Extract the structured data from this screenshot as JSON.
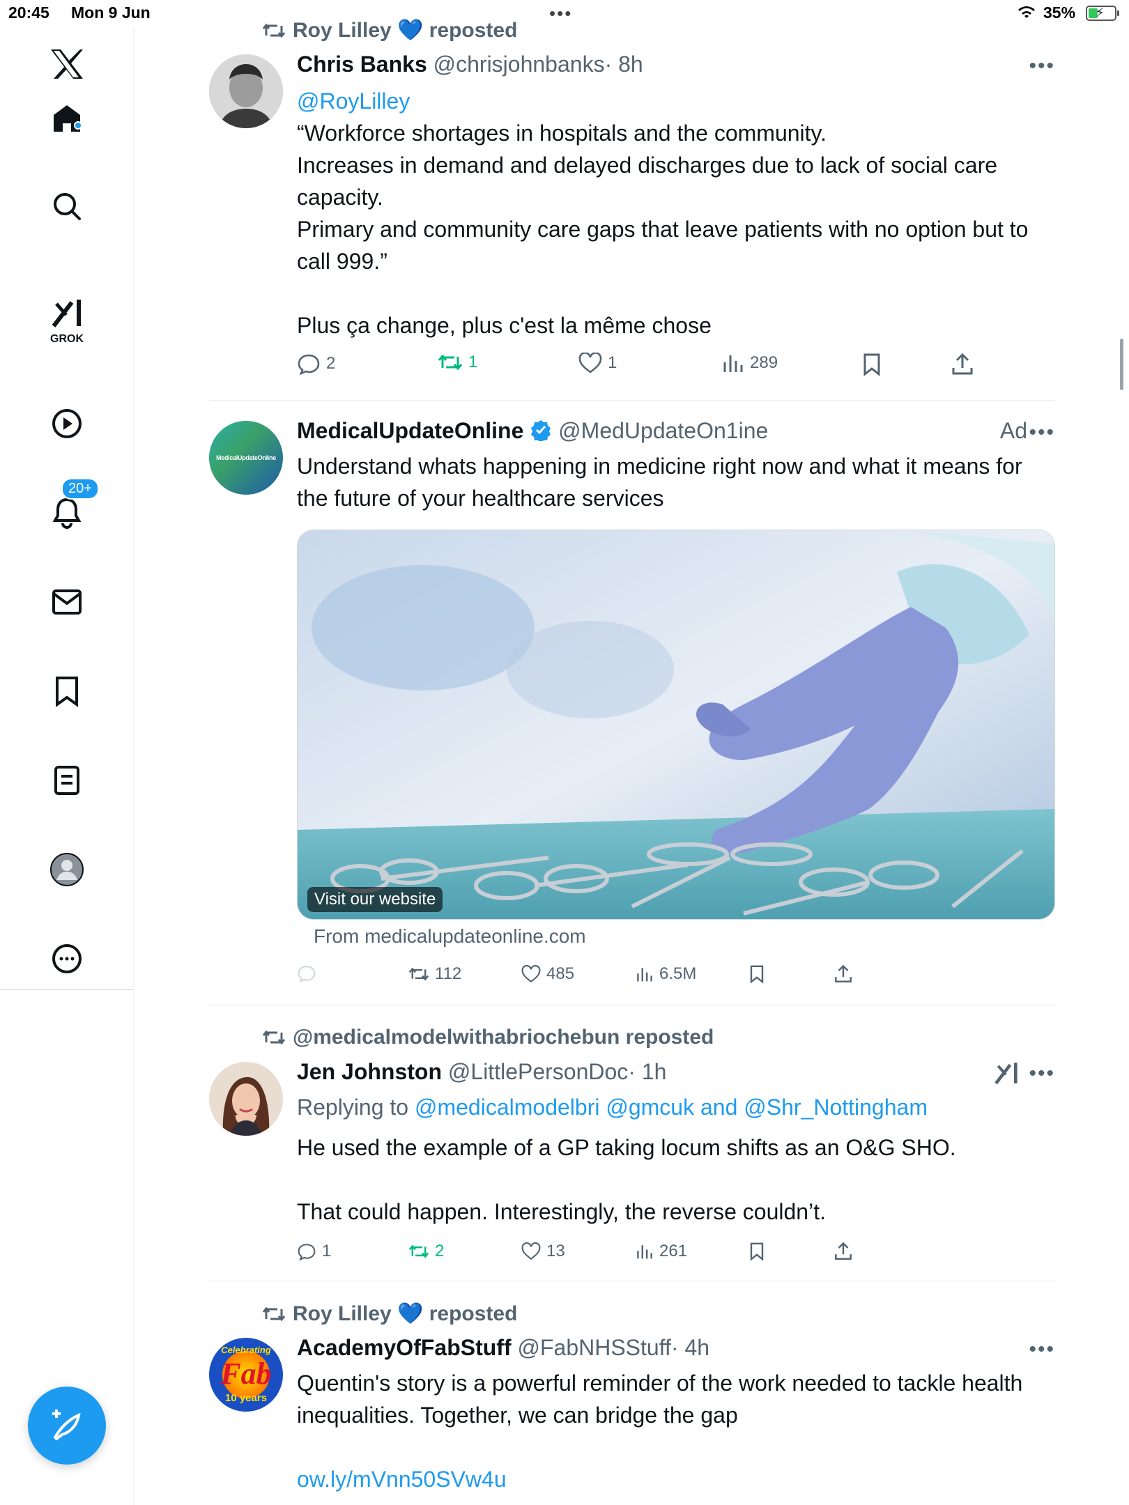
{
  "status_bar": {
    "time": "20:45",
    "date": "Mon 9 Jun",
    "battery": "35%",
    "battery_level_fraction": 0.35
  },
  "sidebar": {
    "grok_label": "GROK",
    "notifications_badge": "20+",
    "items": [
      "x-logo",
      "home",
      "search",
      "grok",
      "video",
      "notifications",
      "messages",
      "bookmarks",
      "lists",
      "profile",
      "more"
    ]
  },
  "posts": [
    {
      "repost_by": "Roy Lilley 💙 reposted",
      "name": "Chris Banks",
      "handle": "@chrisjohnbanks",
      "time": "· 8h",
      "body": [
        "@RoyLilley",
        "“Workforce shortages in hospitals and the community.",
        "Increases in demand and delayed discharges due to lack of social care capacity.",
        "Primary and community care gaps that leave patients with no option but to call 999.”",
        "",
        "Plus ça change, plus c'est la même chose"
      ],
      "replies": "2",
      "reposts": "1",
      "likes": "1",
      "views": "289"
    },
    {
      "name": "MedicalUpdateOnline",
      "handle": "@MedUpdateOn1ine",
      "ad_label": "Ad",
      "avatar_text": "MedicalUpdateOnline",
      "body": "Understand whats happening in medicine right now and what it means for the future of your healthcare services",
      "media_label": "Visit our website",
      "from": "From medicalupdateonline.com",
      "replies": "",
      "reposts": "112",
      "likes": "485",
      "views": "6.5M"
    },
    {
      "repost_by": "@medicalmodelwithabriochebun reposted",
      "name": "Jen Johnston",
      "handle": "@LittlePersonDoc",
      "time": "· 1h",
      "replying_prefix": "Replying to",
      "replying_to": "@medicalmodelbri @gmcuk and @Shr_Nottingham",
      "body": [
        "He used the example of a GP taking locum shifts as an O&G SHO.",
        "",
        "That could happen. Interestingly, the reverse couldn’t."
      ],
      "replies": "1",
      "reposts": "2",
      "likes": "13",
      "views": "261"
    },
    {
      "repost_by": "Roy Lilley 💙 reposted",
      "name": "AcademyOfFabStuff",
      "handle": "@FabNHSStuff",
      "time": "· 4h",
      "avatar_text_top": "Celebrating",
      "avatar_text_main": "Fab",
      "avatar_text_bottom": "10 years",
      "body": [
        "Quentin's story is a powerful reminder of the work needed to tackle health inequalities. Together, we can bridge the gap",
        "",
        "ow.ly/mVnn50SVw4u"
      ]
    }
  ],
  "colors": {
    "accent": "#1d9bf0",
    "text": "#0f1419",
    "muted": "#536471",
    "repost_green": "#00ba7c"
  }
}
